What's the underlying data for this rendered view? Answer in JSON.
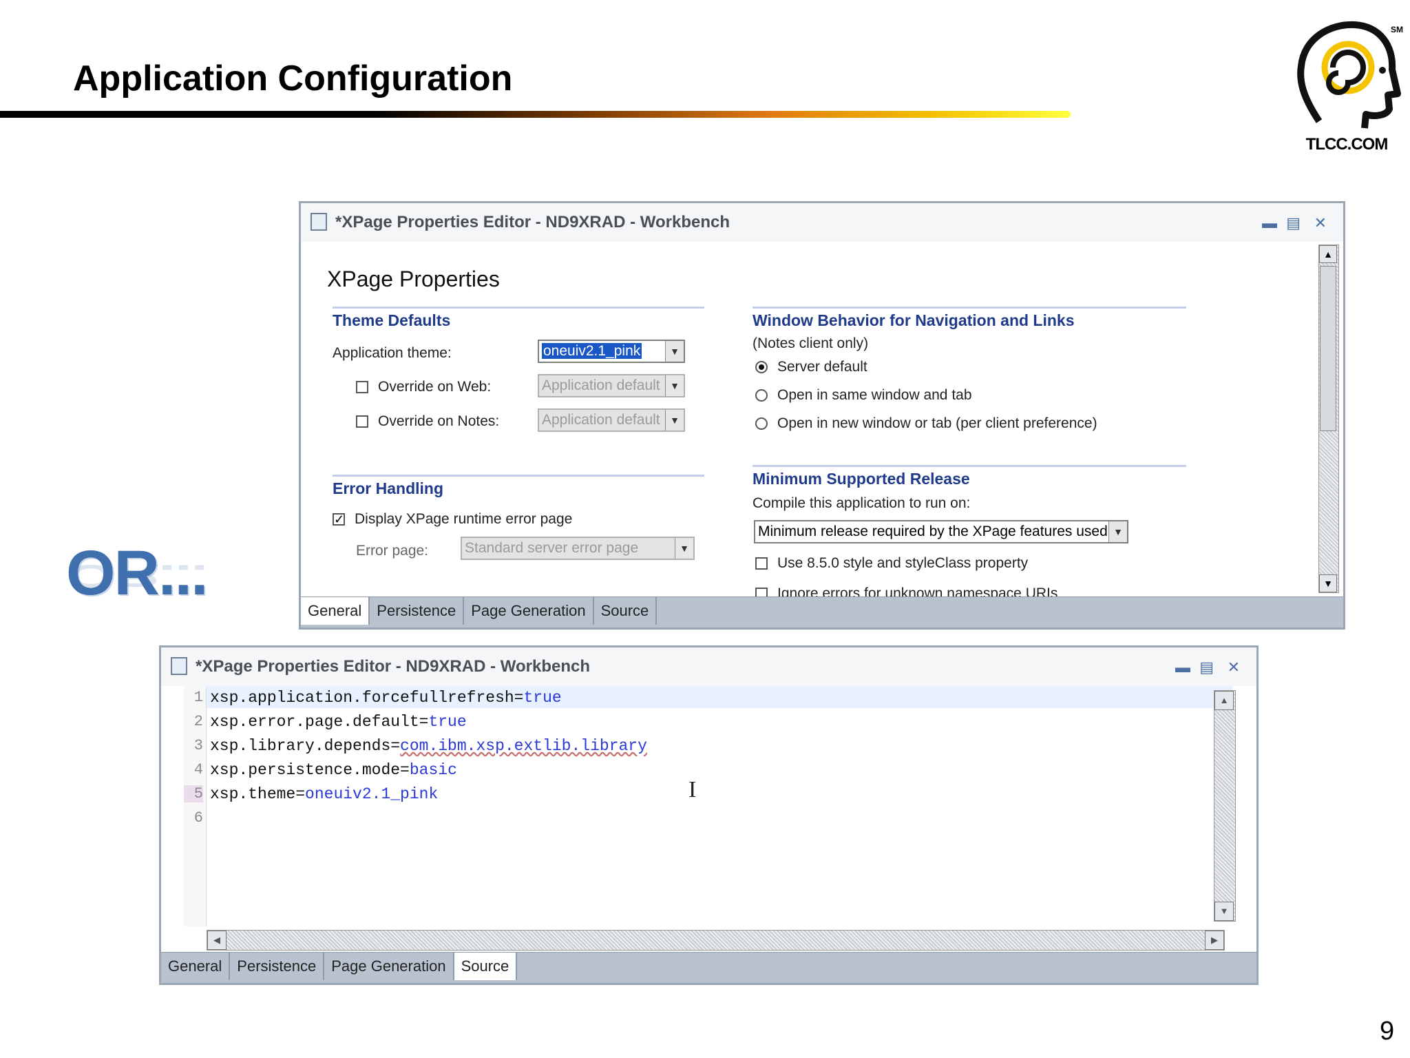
{
  "slide": {
    "title": "Application Configuration",
    "logo_text": "TLCC.COM",
    "logo_mark": "SM",
    "or_text": "OR...",
    "page_number": "9"
  },
  "window1": {
    "title": "*XPage Properties Editor - ND9XRAD - Workbench",
    "heading": "XPage Properties",
    "theme_defaults": {
      "title": "Theme Defaults",
      "app_theme_label": "Application theme:",
      "app_theme_value": "oneuiv2.1_pink",
      "override_web_label": "Override on Web:",
      "override_web_value": "Application default",
      "override_web_checked": false,
      "override_notes_label": "Override on Notes:",
      "override_notes_value": "Application default",
      "override_notes_checked": false
    },
    "error_handling": {
      "title": "Error Handling",
      "display_label": "Display XPage runtime error page",
      "display_checked": true,
      "error_page_label": "Error page:",
      "error_page_value": "Standard server error page"
    },
    "window_behavior": {
      "title": "Window Behavior for Navigation and Links",
      "subtitle": "(Notes client only)",
      "options": [
        {
          "label": "Server default",
          "selected": true
        },
        {
          "label": "Open in same window and tab",
          "selected": false
        },
        {
          "label": "Open in new window or tab (per client preference)",
          "selected": false
        }
      ]
    },
    "min_release": {
      "title": "Minimum Supported Release",
      "compile_label": "Compile this application to run on:",
      "compile_value": "Minimum release required by the XPage features used",
      "style_label": "Use 8.5.0 style and styleClass property",
      "ignore_label": "Ignore errors for unknown namespace URIs"
    },
    "tabs": [
      "General",
      "Persistence",
      "Page Generation",
      "Source"
    ],
    "active_tab": "General"
  },
  "window2": {
    "title": "*XPage Properties Editor - ND9XRAD - Workbench",
    "lines": [
      {
        "num": "1",
        "key": "xsp.application.forcefullrefresh=",
        "value": "true"
      },
      {
        "num": "2",
        "key": "xsp.error.page.default=",
        "value": "true"
      },
      {
        "num": "3",
        "key": "xsp.library.depends=",
        "value": "com.ibm.xsp.extlib.library"
      },
      {
        "num": "4",
        "key": "xsp.persistence.mode=",
        "value": "basic"
      },
      {
        "num": "5",
        "key": "xsp.theme=",
        "value": "oneuiv2.1_pink"
      },
      {
        "num": "6",
        "key": "",
        "value": ""
      }
    ],
    "tabs": [
      "General",
      "Persistence",
      "Page Generation",
      "Source"
    ],
    "active_tab": "Source"
  },
  "colors": {
    "section_title": "#1f3a8a",
    "code_value": "#2a38d6",
    "or_text": "#3f6fad",
    "tabbar": "#b9c3d0"
  }
}
